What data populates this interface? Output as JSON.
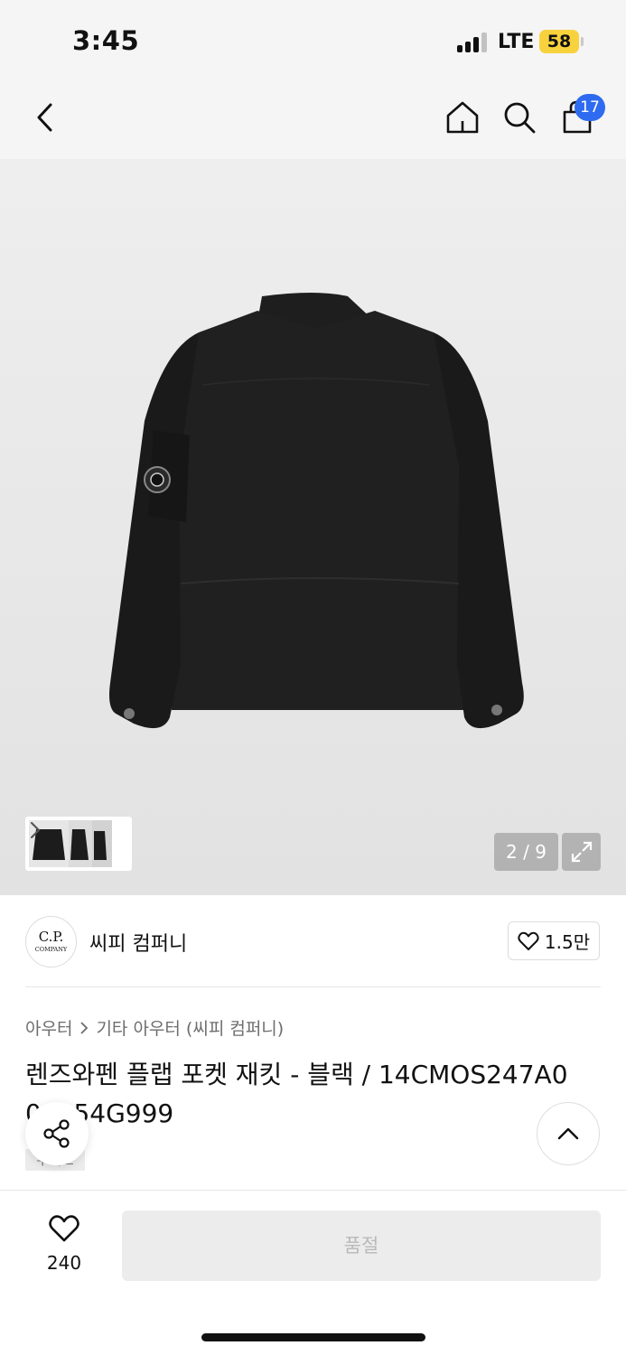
{
  "status_bar": {
    "time": "3:45",
    "network": "LTE",
    "battery": "58",
    "signal_bars_active": 3,
    "signal_bars_total": 4
  },
  "nav": {
    "back_icon": "chevron-left-icon",
    "home_icon": "home-icon",
    "search_icon": "search-icon",
    "cart_icon": "shopping-bag-icon",
    "cart_count": "17"
  },
  "gallery": {
    "page_indicator": "2 / 9",
    "fullscreen_icon": "expand-icon",
    "thumbnail_more_icon": "chevron-right-icon"
  },
  "brand": {
    "logo_text": "C.P.",
    "logo_subtext": "COMPANY",
    "name": "씨피 컴퍼니",
    "likes": "1.5만"
  },
  "category": {
    "level1": "아우터",
    "level2": "기타 아우터 (씨피 컴퍼니)"
  },
  "product": {
    "title": "렌즈와펜 플랩 포켓 재킷 - 블랙 / 14CMOS247A0 06154G999",
    "tag": "무배포"
  },
  "actions": {
    "wish_count": "240",
    "buy_label": "품절"
  },
  "colors": {
    "background": "#f5f5f5",
    "badge": "#2f6bf0",
    "battery": "#f7d23d",
    "soldout_bg": "#ececec",
    "soldout_text": "#b9b9b9"
  }
}
